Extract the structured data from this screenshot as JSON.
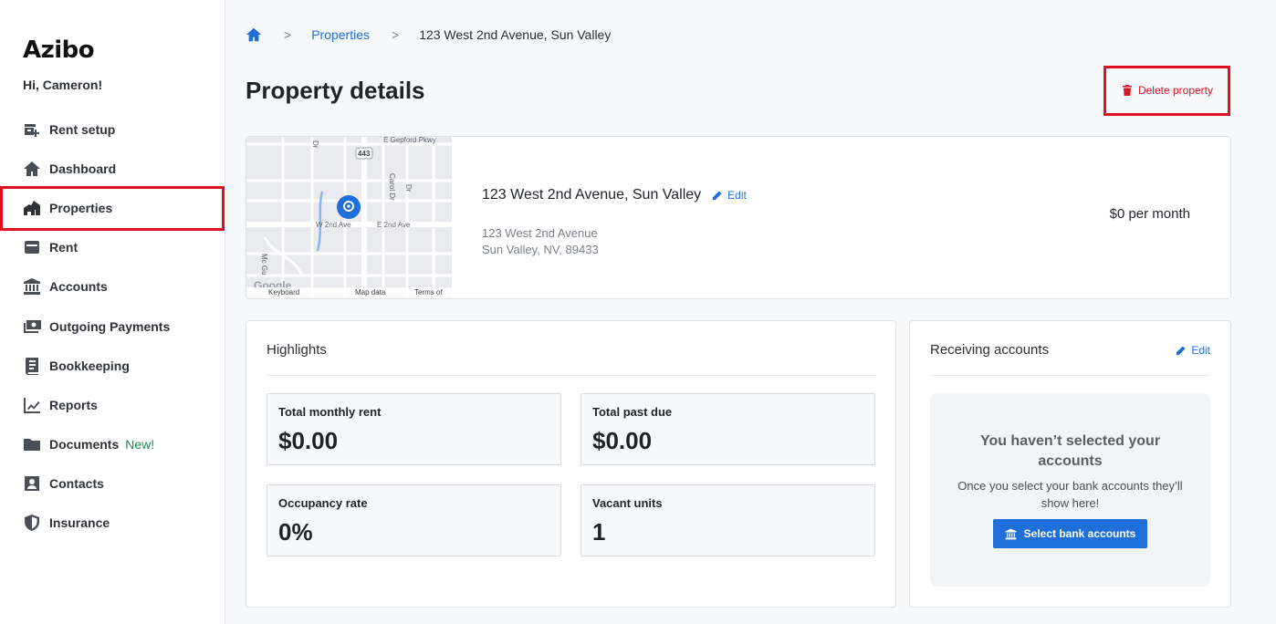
{
  "app": {
    "brand": "Azibo",
    "greeting": "Hi, Cameron!",
    "accent_color": "#1e6fd9",
    "danger_color": "#d0192b"
  },
  "sidebar": {
    "items": [
      {
        "label": "Rent setup",
        "icon": "rent-setup-icon"
      },
      {
        "label": "Dashboard",
        "icon": "home-icon"
      },
      {
        "label": "Properties",
        "icon": "properties-icon",
        "active": true
      },
      {
        "label": "Rent",
        "icon": "card-icon"
      },
      {
        "label": "Accounts",
        "icon": "bank-icon"
      },
      {
        "label": "Outgoing Payments",
        "icon": "money-icon"
      },
      {
        "label": "Bookkeeping",
        "icon": "ledger-icon"
      },
      {
        "label": "Reports",
        "icon": "chart-icon"
      },
      {
        "label": "Documents",
        "icon": "folder-icon",
        "badge": "New!"
      },
      {
        "label": "Contacts",
        "icon": "contact-icon"
      },
      {
        "label": "Insurance",
        "icon": "shield-icon"
      }
    ]
  },
  "breadcrumb": {
    "home_icon": "home-icon",
    "sep": ">",
    "link": "Properties",
    "current": "123 West 2nd Avenue, Sun Valley"
  },
  "page": {
    "title": "Property details",
    "delete_label": "Delete property"
  },
  "property": {
    "name": "123 West 2nd Avenue, Sun Valley",
    "edit_label": "Edit",
    "address_line1": "123 West 2nd Avenue",
    "address_line2": "Sun Valley, NV, 89433",
    "rent": "$0 per month",
    "map": {
      "labels": [
        "E Gepford Pkwy",
        "443",
        "Carol Dr",
        "W 2nd Ave",
        "E 2nd Ave",
        "Mc Gu",
        "Dr",
        "Dr"
      ],
      "footer": [
        "Keyboard",
        "Map data",
        "Terms of"
      ],
      "logo": "Google"
    }
  },
  "highlights": {
    "title": "Highlights",
    "stats": [
      {
        "label": "Total monthly rent",
        "value": "$0.00"
      },
      {
        "label": "Total past due",
        "value": "$0.00"
      },
      {
        "label": "Occupancy rate",
        "value": "0%"
      },
      {
        "label": "Vacant units",
        "value": "1"
      }
    ]
  },
  "receiving": {
    "title": "Receiving accounts",
    "edit_label": "Edit",
    "empty_title": "You haven’t selected your accounts",
    "empty_sub": "Once you select your bank accounts they’ll show here!",
    "button_label": "Select bank accounts"
  }
}
